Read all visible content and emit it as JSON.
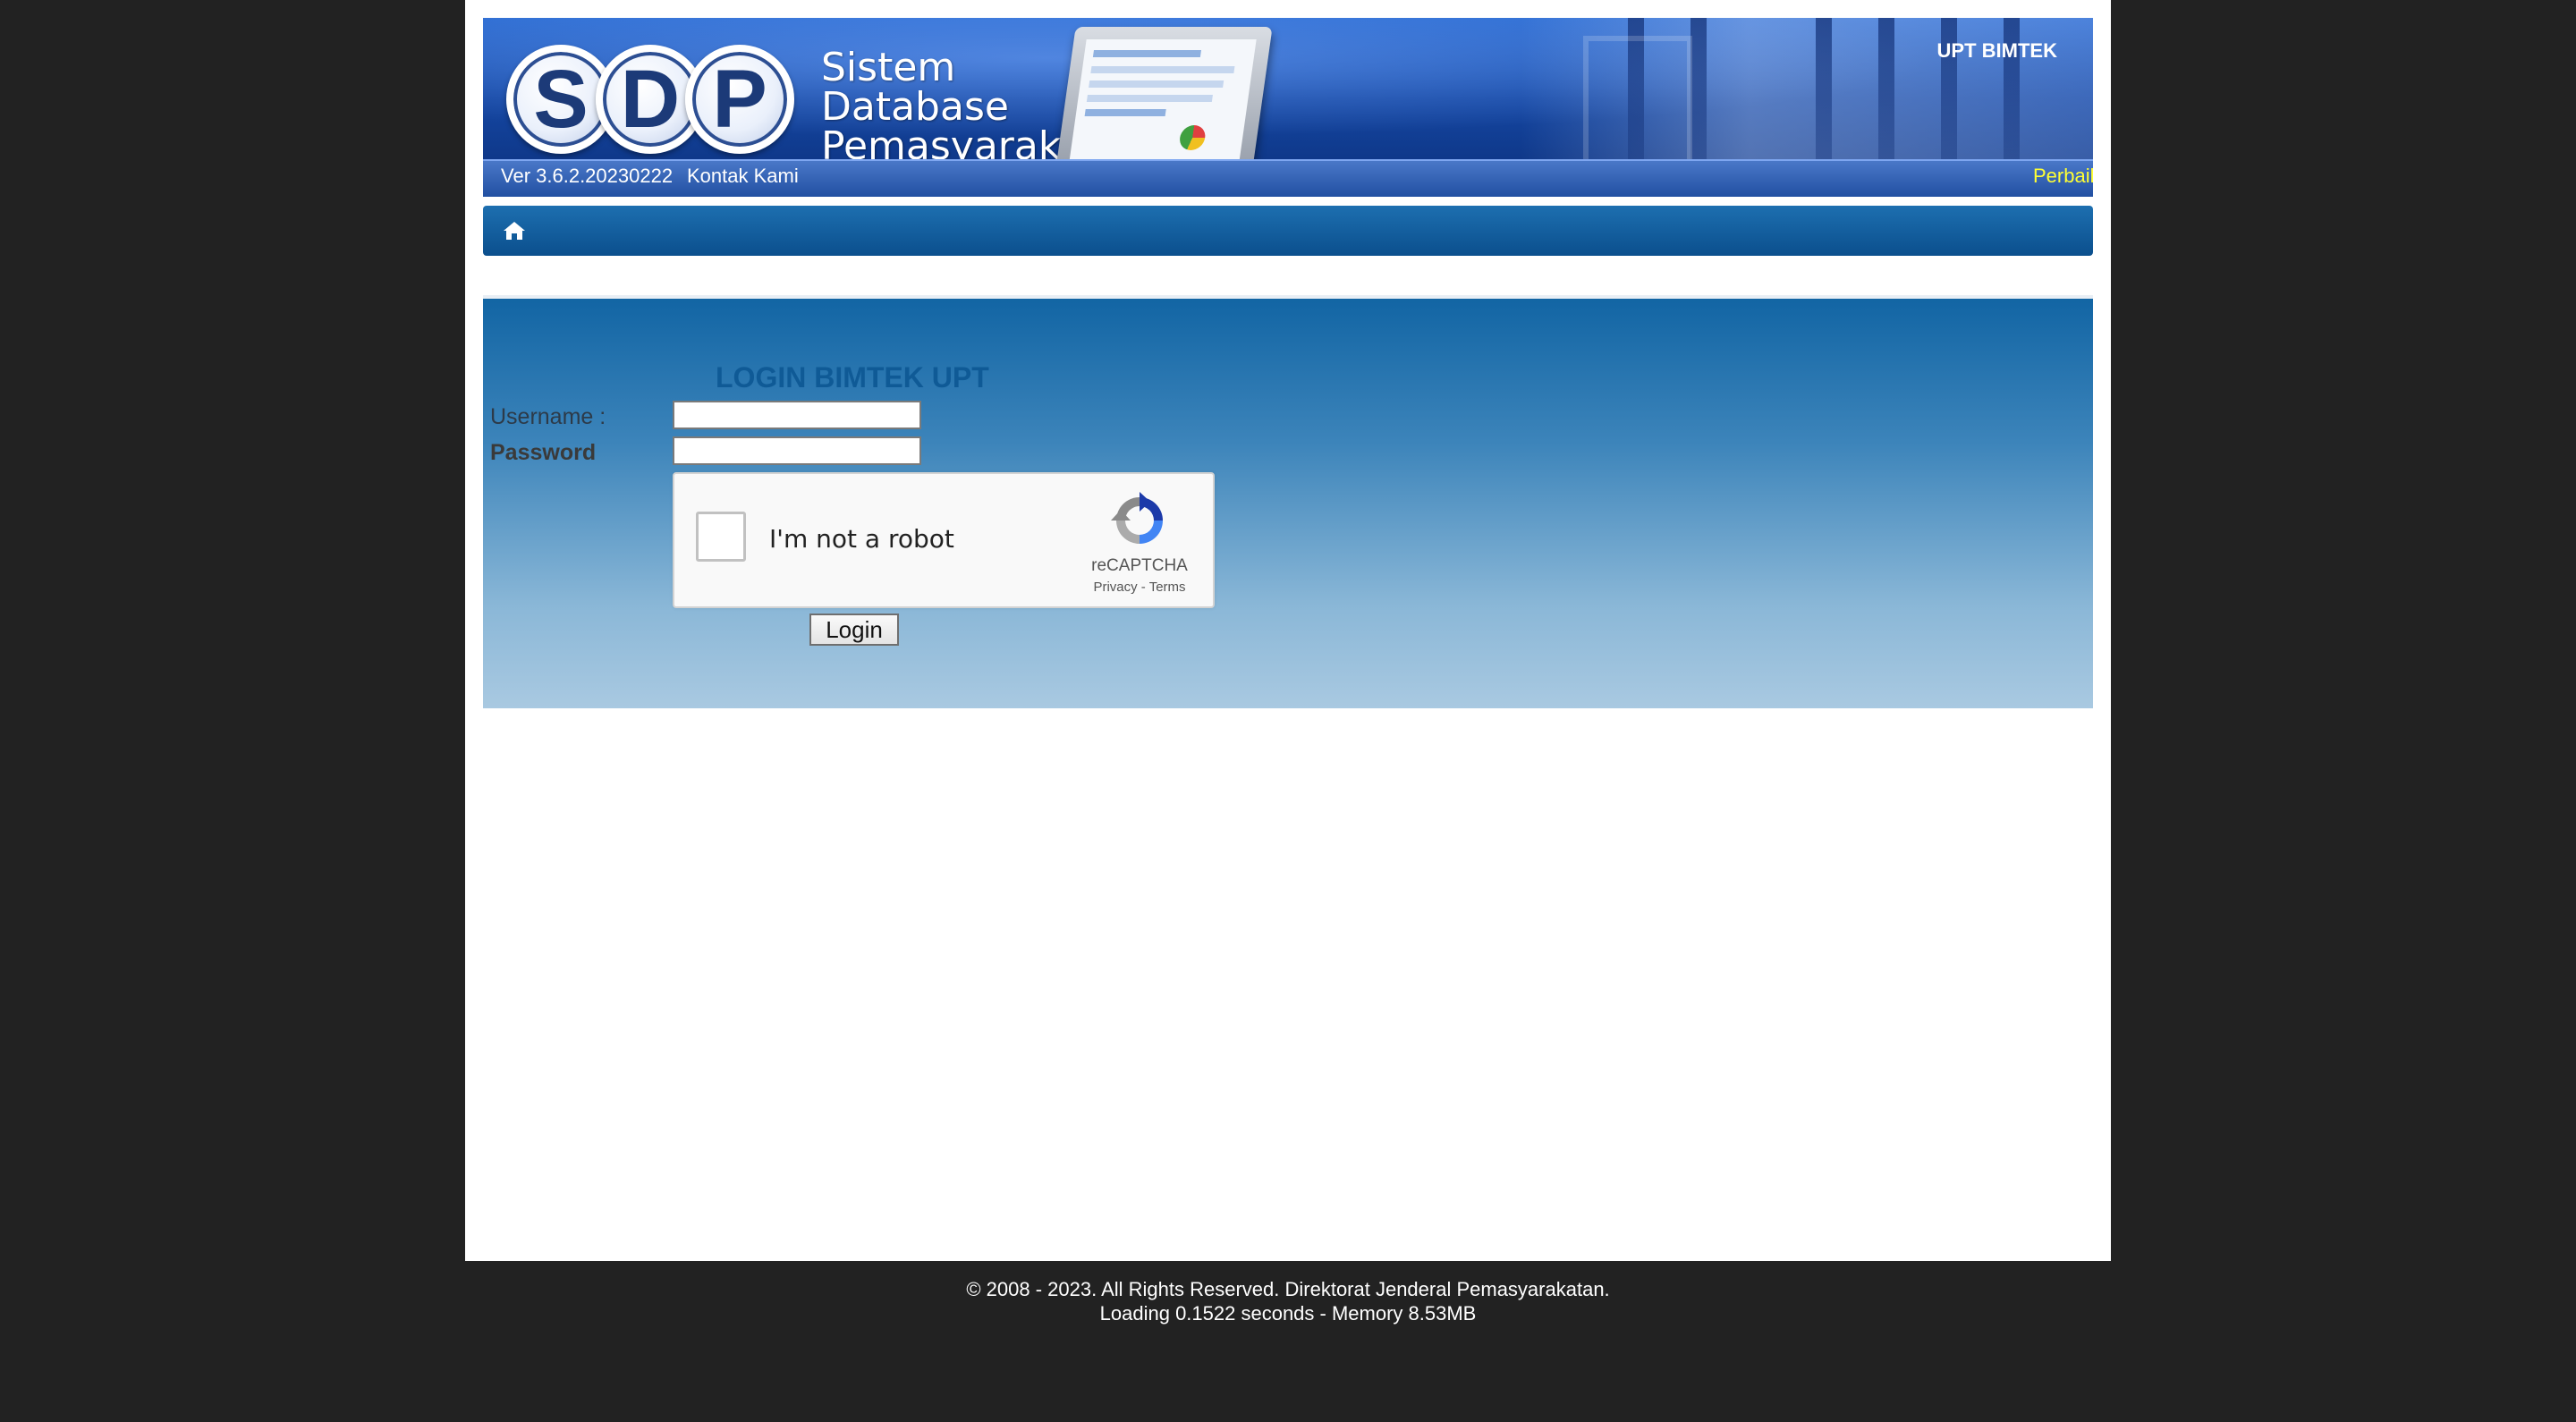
{
  "banner": {
    "logo_letters": [
      "S",
      "D",
      "P"
    ],
    "brand_lines": [
      "Sistem",
      "Database",
      "Pemasyarakatan"
    ],
    "user_label": "UPT BIMTEK",
    "version": "Ver 3.6.2.20230222",
    "contact_link": "Kontak Kami",
    "notice": "Perbaikan",
    "notice_color": "#ffff33"
  },
  "navbar": {
    "home_icon": "home-icon",
    "color": "#0b4f8d"
  },
  "login": {
    "title": "LOGIN BIMTEK UPT",
    "username_label": "Username :",
    "password_label": "Password",
    "username_value": "",
    "password_value": "",
    "captcha": {
      "checkbox_label": "I'm not a robot",
      "brand": "reCAPTCHA",
      "privacy_link": "Privacy",
      "separator": "-",
      "terms_link": "Terms",
      "logo_icon": "recaptcha-icon"
    },
    "submit_label": "Login"
  },
  "footer": {
    "copyright": "© 2008 - 2023. All Rights Reserved. Direktorat Jenderal Pemasyarakatan.",
    "stats": "Loading 0.1522 seconds - Memory 8.53MB"
  }
}
